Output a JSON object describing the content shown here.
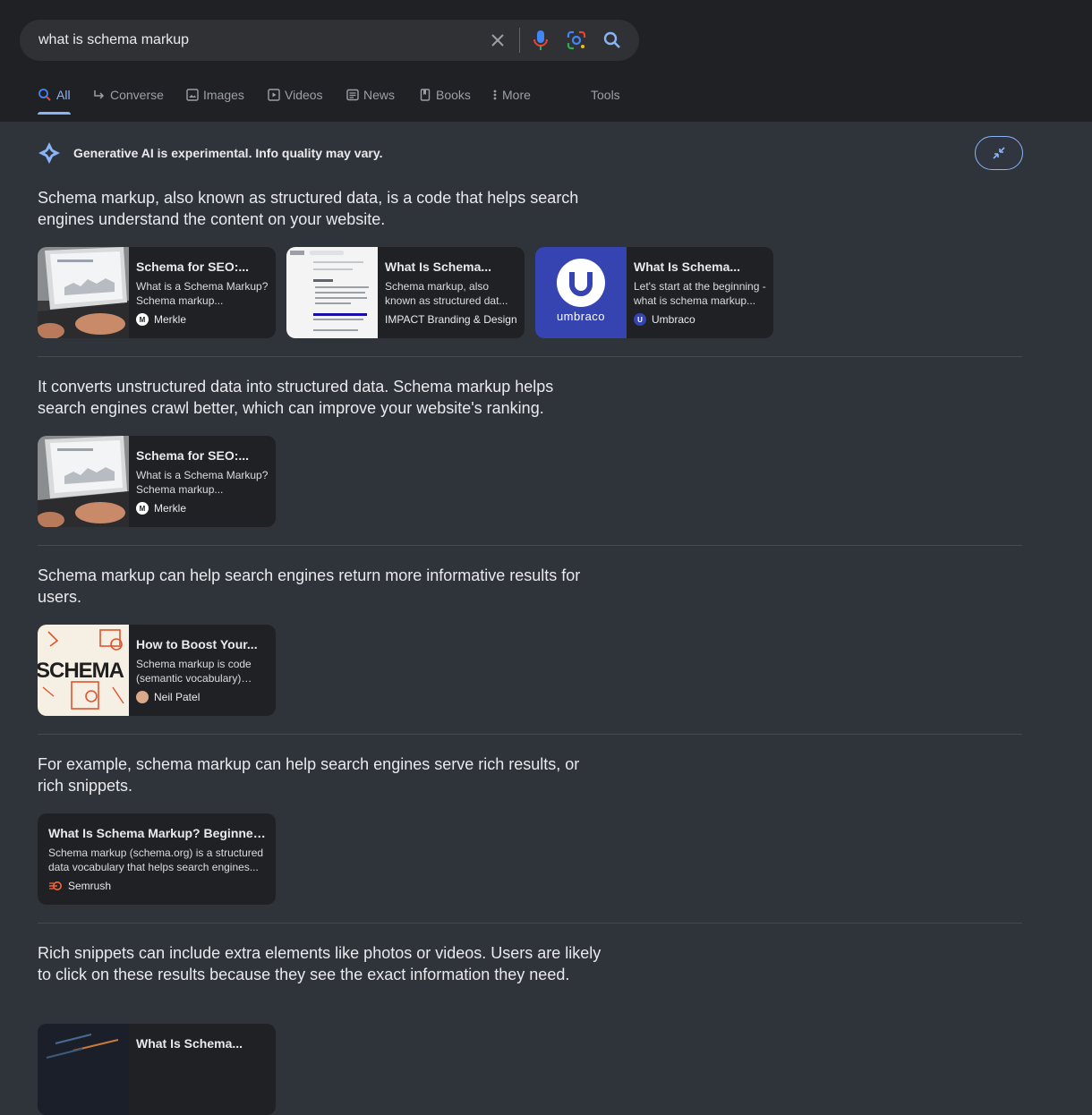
{
  "search": {
    "query": "what is schema markup"
  },
  "tabs": [
    {
      "label": "All"
    },
    {
      "label": "Converse"
    },
    {
      "label": "Images"
    },
    {
      "label": "Videos"
    },
    {
      "label": "News"
    },
    {
      "label": "Books"
    },
    {
      "label": "More"
    }
  ],
  "tools_label": "Tools",
  "ai": {
    "banner": "Generative AI is experimental. Info quality may vary."
  },
  "sections": [
    {
      "text": "Schema markup, also known as structured data, is a code that helps search engines understand the content on your website.",
      "cards": [
        {
          "title": "Schema for SEO:...",
          "snippet": "What is a Schema Markup? Schema markup...",
          "source": "Merkle"
        },
        {
          "title": "What Is Schema...",
          "snippet": "Schema markup, also known as structured dat...",
          "source": "IMPACT Branding & Design"
        },
        {
          "title": "What Is Schema...",
          "snippet": "Let's start at the beginning - what is schema markup...",
          "source": "Umbraco",
          "logo_text": "umbraco"
        }
      ]
    },
    {
      "text": "It converts unstructured data into structured data. Schema markup helps search engines crawl better, which can improve your website's ranking.",
      "cards": [
        {
          "title": "Schema for SEO:...",
          "snippet": "What is a Schema Markup? Schema markup...",
          "source": "Merkle"
        }
      ]
    },
    {
      "text": "Schema markup can help search engines return more informative results for users.",
      "cards": [
        {
          "title": "How to Boost Your...",
          "snippet": "Schema markup is code (semantic vocabulary) that...",
          "source": "Neil Patel",
          "logo_text": "SCHEMA"
        }
      ]
    },
    {
      "text": "For example, schema markup can help search engines serve rich results, or rich snippets.",
      "cards": [
        {
          "title": "What Is Schema Markup? Beginner'...",
          "snippet": "Schema markup (schema.org) is a structured data vocabulary that helps search engines...",
          "source": "Semrush"
        }
      ]
    },
    {
      "text": "Rich snippets can include extra elements like photos or videos. Users are likely to click on these results because they see the exact information they need.",
      "cards": [
        {
          "title": "What Is Schema...",
          "snippet": "",
          "source": ""
        }
      ]
    }
  ],
  "colors": {
    "accent": "#8ab4f8",
    "background": "#2f333a",
    "header": "#202124",
    "card": "#202124"
  }
}
